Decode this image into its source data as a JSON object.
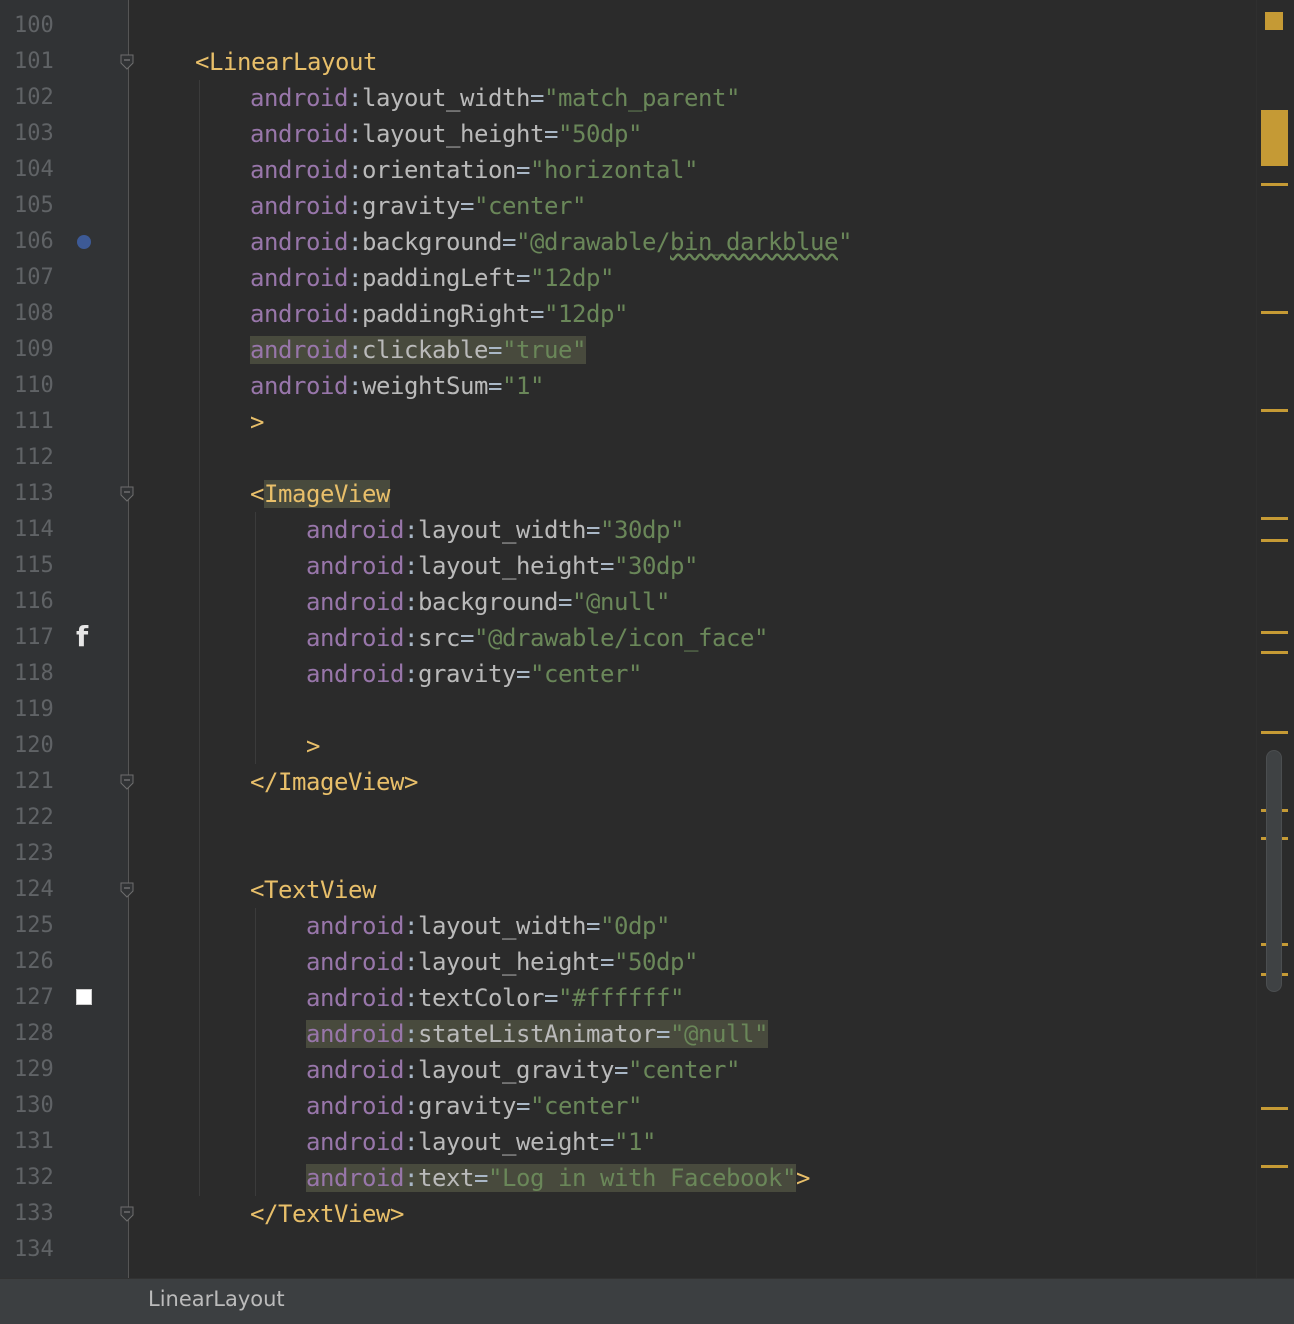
{
  "lines": [
    {
      "num": "100",
      "indent": 0,
      "tokens": []
    },
    {
      "num": "101",
      "indent": 1,
      "tokens": [
        {
          "t": "<",
          "c": "tag"
        },
        {
          "t": "LinearLayout",
          "c": "tagname"
        }
      ],
      "fold": true
    },
    {
      "num": "102",
      "indent": 2,
      "tokens": [
        {
          "t": "android",
          "c": "ns"
        },
        {
          "t": ":",
          "c": "colon"
        },
        {
          "t": "layout_width",
          "c": "attr"
        },
        {
          "t": "=",
          "c": "eq"
        },
        {
          "t": "\"match_parent\"",
          "c": "str"
        }
      ]
    },
    {
      "num": "103",
      "indent": 2,
      "tokens": [
        {
          "t": "android",
          "c": "ns"
        },
        {
          "t": ":",
          "c": "colon"
        },
        {
          "t": "layout_height",
          "c": "attr"
        },
        {
          "t": "=",
          "c": "eq"
        },
        {
          "t": "\"50dp\"",
          "c": "str"
        }
      ]
    },
    {
      "num": "104",
      "indent": 2,
      "tokens": [
        {
          "t": "android",
          "c": "ns"
        },
        {
          "t": ":",
          "c": "colon"
        },
        {
          "t": "orientation",
          "c": "attr"
        },
        {
          "t": "=",
          "c": "eq"
        },
        {
          "t": "\"horizontal\"",
          "c": "str"
        }
      ]
    },
    {
      "num": "105",
      "indent": 2,
      "tokens": [
        {
          "t": "android",
          "c": "ns"
        },
        {
          "t": ":",
          "c": "colon"
        },
        {
          "t": "gravity",
          "c": "attr"
        },
        {
          "t": "=",
          "c": "eq"
        },
        {
          "t": "\"center\"",
          "c": "str"
        }
      ]
    },
    {
      "num": "106",
      "indent": 2,
      "tokens": [
        {
          "t": "android",
          "c": "ns"
        },
        {
          "t": ":",
          "c": "colon"
        },
        {
          "t": "background",
          "c": "attr"
        },
        {
          "t": "=",
          "c": "eq"
        },
        {
          "t": "\"@drawable/",
          "c": "str"
        },
        {
          "t": "bin_darkblue",
          "c": "str wavy"
        },
        {
          "t": "\"",
          "c": "str"
        }
      ]
    },
    {
      "num": "107",
      "indent": 2,
      "tokens": [
        {
          "t": "android",
          "c": "ns"
        },
        {
          "t": ":",
          "c": "colon"
        },
        {
          "t": "paddingLeft",
          "c": "attr"
        },
        {
          "t": "=",
          "c": "eq"
        },
        {
          "t": "\"12dp\"",
          "c": "str"
        }
      ]
    },
    {
      "num": "108",
      "indent": 2,
      "tokens": [
        {
          "t": "android",
          "c": "ns"
        },
        {
          "t": ":",
          "c": "colon"
        },
        {
          "t": "paddingRight",
          "c": "attr"
        },
        {
          "t": "=",
          "c": "eq"
        },
        {
          "t": "\"12dp\"",
          "c": "str"
        }
      ]
    },
    {
      "num": "109",
      "indent": 2,
      "tokens": [
        {
          "t": "android",
          "c": "ns hl"
        },
        {
          "t": ":",
          "c": "colon hl"
        },
        {
          "t": "clickable",
          "c": "attr hl"
        },
        {
          "t": "=",
          "c": "eq hl"
        },
        {
          "t": "\"true\"",
          "c": "str hl"
        }
      ]
    },
    {
      "num": "110",
      "indent": 2,
      "tokens": [
        {
          "t": "android",
          "c": "ns"
        },
        {
          "t": ":",
          "c": "colon"
        },
        {
          "t": "weightSum",
          "c": "attr"
        },
        {
          "t": "=",
          "c": "eq"
        },
        {
          "t": "\"1\"",
          "c": "str"
        }
      ]
    },
    {
      "num": "111",
      "indent": 2,
      "tokens": [
        {
          "t": ">",
          "c": "tag"
        }
      ]
    },
    {
      "num": "112",
      "indent": 0,
      "tokens": []
    },
    {
      "num": "113",
      "indent": 2,
      "tokens": [
        {
          "t": "<",
          "c": "tag"
        },
        {
          "t": "ImageView",
          "c": "tagname hl"
        }
      ],
      "fold": true
    },
    {
      "num": "114",
      "indent": 3,
      "tokens": [
        {
          "t": "android",
          "c": "ns"
        },
        {
          "t": ":",
          "c": "colon"
        },
        {
          "t": "layout_width",
          "c": "attr"
        },
        {
          "t": "=",
          "c": "eq"
        },
        {
          "t": "\"30dp\"",
          "c": "str"
        }
      ]
    },
    {
      "num": "115",
      "indent": 3,
      "tokens": [
        {
          "t": "android",
          "c": "ns"
        },
        {
          "t": ":",
          "c": "colon"
        },
        {
          "t": "layout_height",
          "c": "attr"
        },
        {
          "t": "=",
          "c": "eq"
        },
        {
          "t": "\"30dp\"",
          "c": "str"
        }
      ]
    },
    {
      "num": "116",
      "indent": 3,
      "tokens": [
        {
          "t": "android",
          "c": "ns"
        },
        {
          "t": ":",
          "c": "colon"
        },
        {
          "t": "background",
          "c": "attr"
        },
        {
          "t": "=",
          "c": "eq"
        },
        {
          "t": "\"@null\"",
          "c": "str"
        }
      ]
    },
    {
      "num": "117",
      "indent": 3,
      "tokens": [
        {
          "t": "android",
          "c": "ns"
        },
        {
          "t": ":",
          "c": "colon"
        },
        {
          "t": "src",
          "c": "attr"
        },
        {
          "t": "=",
          "c": "eq"
        },
        {
          "t": "\"@drawable/icon_face\"",
          "c": "str"
        }
      ]
    },
    {
      "num": "118",
      "indent": 3,
      "tokens": [
        {
          "t": "android",
          "c": "ns"
        },
        {
          "t": ":",
          "c": "colon"
        },
        {
          "t": "gravity",
          "c": "attr"
        },
        {
          "t": "=",
          "c": "eq"
        },
        {
          "t": "\"center\"",
          "c": "str"
        }
      ]
    },
    {
      "num": "119",
      "indent": 0,
      "tokens": []
    },
    {
      "num": "120",
      "indent": 3,
      "tokens": [
        {
          "t": ">",
          "c": "tag"
        }
      ]
    },
    {
      "num": "121",
      "indent": 2,
      "tokens": [
        {
          "t": "</",
          "c": "tag"
        },
        {
          "t": "ImageView",
          "c": "tagname"
        },
        {
          "t": ">",
          "c": "tag"
        }
      ],
      "fold": true
    },
    {
      "num": "122",
      "indent": 0,
      "tokens": []
    },
    {
      "num": "123",
      "indent": 0,
      "tokens": []
    },
    {
      "num": "124",
      "indent": 2,
      "tokens": [
        {
          "t": "<",
          "c": "tag"
        },
        {
          "t": "TextView",
          "c": "tagname"
        }
      ],
      "fold": true
    },
    {
      "num": "125",
      "indent": 3,
      "tokens": [
        {
          "t": "android",
          "c": "ns"
        },
        {
          "t": ":",
          "c": "colon"
        },
        {
          "t": "layout_width",
          "c": "attr"
        },
        {
          "t": "=",
          "c": "eq"
        },
        {
          "t": "\"0dp\"",
          "c": "str"
        }
      ]
    },
    {
      "num": "126",
      "indent": 3,
      "tokens": [
        {
          "t": "android",
          "c": "ns"
        },
        {
          "t": ":",
          "c": "colon"
        },
        {
          "t": "layout_height",
          "c": "attr"
        },
        {
          "t": "=",
          "c": "eq"
        },
        {
          "t": "\"50dp\"",
          "c": "str"
        }
      ]
    },
    {
      "num": "127",
      "indent": 3,
      "tokens": [
        {
          "t": "android",
          "c": "ns"
        },
        {
          "t": ":",
          "c": "colon"
        },
        {
          "t": "textColor",
          "c": "attr"
        },
        {
          "t": "=",
          "c": "eq"
        },
        {
          "t": "\"#ffffff\"",
          "c": "str"
        }
      ]
    },
    {
      "num": "128",
      "indent": 3,
      "tokens": [
        {
          "t": "android",
          "c": "ns hl"
        },
        {
          "t": ":",
          "c": "colon hl"
        },
        {
          "t": "stateListAnimator",
          "c": "attr hl"
        },
        {
          "t": "=",
          "c": "eq hl"
        },
        {
          "t": "\"@null\"",
          "c": "str hl"
        }
      ]
    },
    {
      "num": "129",
      "indent": 3,
      "tokens": [
        {
          "t": "android",
          "c": "ns"
        },
        {
          "t": ":",
          "c": "colon"
        },
        {
          "t": "layout_gravity",
          "c": "attr"
        },
        {
          "t": "=",
          "c": "eq"
        },
        {
          "t": "\"center\"",
          "c": "str"
        }
      ]
    },
    {
      "num": "130",
      "indent": 3,
      "tokens": [
        {
          "t": "android",
          "c": "ns"
        },
        {
          "t": ":",
          "c": "colon"
        },
        {
          "t": "gravity",
          "c": "attr"
        },
        {
          "t": "=",
          "c": "eq"
        },
        {
          "t": "\"center\"",
          "c": "str"
        }
      ]
    },
    {
      "num": "131",
      "indent": 3,
      "tokens": [
        {
          "t": "android",
          "c": "ns"
        },
        {
          "t": ":",
          "c": "colon"
        },
        {
          "t": "layout_weight",
          "c": "attr"
        },
        {
          "t": "=",
          "c": "eq"
        },
        {
          "t": "\"1\"",
          "c": "str"
        }
      ]
    },
    {
      "num": "132",
      "indent": 3,
      "tokens": [
        {
          "t": "android",
          "c": "ns hl"
        },
        {
          "t": ":",
          "c": "colon hl"
        },
        {
          "t": "text",
          "c": "attr hl"
        },
        {
          "t": "=",
          "c": "eq hl"
        },
        {
          "t": "\"Log in with Facebook\"",
          "c": "str hl"
        },
        {
          "t": ">",
          "c": "tag"
        }
      ]
    },
    {
      "num": "133",
      "indent": 2,
      "tokens": [
        {
          "t": "</",
          "c": "tag"
        },
        {
          "t": "TextView",
          "c": "tagname"
        },
        {
          "t": ">",
          "c": "tag"
        }
      ],
      "fold": true
    },
    {
      "num": "134",
      "indent": 0,
      "tokens": []
    }
  ],
  "gutter": {
    "breakpoint_line": "106",
    "facebook_icon_line": "117",
    "facebook_icon_glyph": "f",
    "color_swatch_line": "127",
    "color_swatch_value": "#ffffff"
  },
  "colors": {
    "background": "#2b2b2b",
    "gutter": "#313335",
    "namespace": "#9876aa",
    "attribute": "#bababa",
    "string": "#6a8759",
    "tag": "#e8bf6a",
    "warning_mark": "#c59a35",
    "highlight": "#484a3d"
  },
  "statusbar": {
    "breadcrumb": "LinearLayout"
  }
}
